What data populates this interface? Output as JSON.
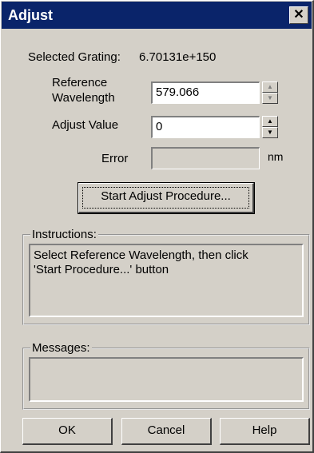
{
  "window": {
    "title": "Adjust",
    "close_label": "✕"
  },
  "grating": {
    "label": "Selected Grating:",
    "value": "6.70131e+150"
  },
  "reference_wavelength": {
    "label_line1": "Reference",
    "label_line2": "Wavelength",
    "value": "579.066"
  },
  "adjust_value": {
    "label": "Adjust Value",
    "value": "0"
  },
  "error": {
    "label": "Error",
    "value": "",
    "unit": "nm"
  },
  "start_button": {
    "label": "Start Adjust Procedure..."
  },
  "instructions": {
    "title": "Instructions:",
    "text_line1": "Select Reference Wavelength, then click",
    "text_line2": "'Start Procedure...' button"
  },
  "messages": {
    "title": "Messages:",
    "text": ""
  },
  "footer": {
    "ok_label": "OK",
    "cancel_label": "Cancel",
    "help_label": "Help"
  },
  "spin_icons": {
    "up": "▲",
    "down": "▼"
  }
}
